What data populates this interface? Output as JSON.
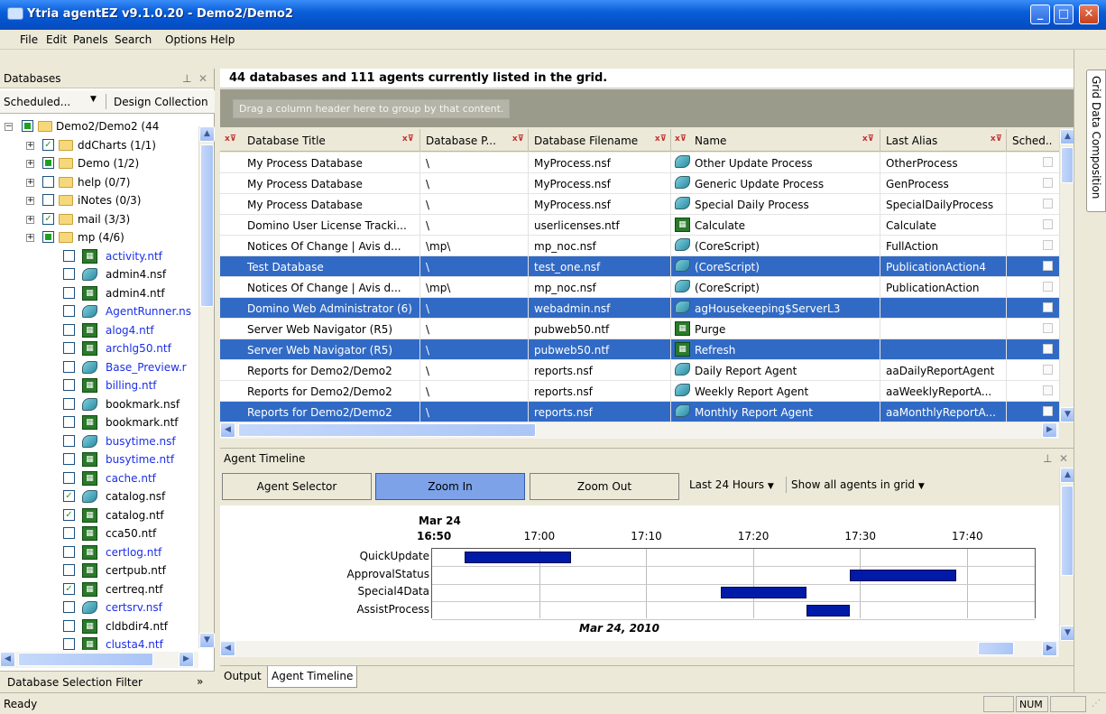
{
  "window": {
    "title": "Ytria agentEZ v9.1.0.20 - Demo2/Demo2",
    "min": "_",
    "max": "□",
    "close": "✕"
  },
  "menu": [
    "File",
    "Edit",
    "Panels",
    "Search",
    "Options",
    "Help"
  ],
  "databases_panel": {
    "title": "Databases",
    "pin": "⊥",
    "close": "✕",
    "tab_scheduled": "Scheduled...",
    "tab_design": "Design Collection",
    "tree": [
      {
        "label": "Demo2/Demo2 (44",
        "kind": "root"
      },
      {
        "label": "ddCharts (1/1)",
        "kind": "folder",
        "check": "checked"
      },
      {
        "label": "Demo (1/2)",
        "kind": "folder",
        "check": "partial"
      },
      {
        "label": "help (0/7)",
        "kind": "folder",
        "check": "none"
      },
      {
        "label": "iNotes (0/3)",
        "kind": "folder",
        "check": "none"
      },
      {
        "label": "mail (3/3)",
        "kind": "folder",
        "check": "checked"
      },
      {
        "label": "mp (4/6)",
        "kind": "folder",
        "check": "partial"
      },
      {
        "label": "activity.ntf",
        "kind": "nsf",
        "blue": true
      },
      {
        "label": "admin4.nsf",
        "kind": "agent",
        "blue": false
      },
      {
        "label": "admin4.ntf",
        "kind": "nsf",
        "blue": false
      },
      {
        "label": "AgentRunner.ns",
        "kind": "agent",
        "blue": true
      },
      {
        "label": "alog4.ntf",
        "kind": "nsf",
        "blue": true
      },
      {
        "label": "archlg50.ntf",
        "kind": "nsf",
        "blue": true
      },
      {
        "label": "Base_Preview.r",
        "kind": "agent",
        "blue": true
      },
      {
        "label": "billing.ntf",
        "kind": "nsf",
        "blue": true
      },
      {
        "label": "bookmark.nsf",
        "kind": "agent",
        "blue": false
      },
      {
        "label": "bookmark.ntf",
        "kind": "nsf",
        "blue": false
      },
      {
        "label": "busytime.nsf",
        "kind": "agent",
        "blue": true
      },
      {
        "label": "busytime.ntf",
        "kind": "nsf",
        "blue": true
      },
      {
        "label": "cache.ntf",
        "kind": "nsf",
        "blue": true
      },
      {
        "label": "catalog.nsf",
        "kind": "agent",
        "blue": false,
        "check": "checked"
      },
      {
        "label": "catalog.ntf",
        "kind": "nsf",
        "blue": false,
        "check": "checked"
      },
      {
        "label": "cca50.ntf",
        "kind": "nsf",
        "blue": false
      },
      {
        "label": "certlog.ntf",
        "kind": "nsf",
        "blue": true
      },
      {
        "label": "certpub.ntf",
        "kind": "nsf",
        "blue": false
      },
      {
        "label": "certreq.ntf",
        "kind": "nsf",
        "blue": false,
        "check": "checked"
      },
      {
        "label": "certsrv.nsf",
        "kind": "agent",
        "blue": true
      },
      {
        "label": "cldbdir4.ntf",
        "kind": "nsf",
        "blue": false
      },
      {
        "label": "clusta4.ntf",
        "kind": "nsf",
        "blue": true
      }
    ],
    "filter_label": "Database Selection Filter"
  },
  "grid": {
    "summary": "44 databases and 111 agents currently listed in the grid.",
    "group_hint": "Drag a column header here to group by that content.",
    "columns": [
      "Database Title",
      "Database P...",
      "Database Filename",
      "Name",
      "Last Alias",
      "Sched.."
    ],
    "rows": [
      {
        "title": "My Process Database",
        "path": "\\",
        "file": "MyProcess.nsf",
        "name": "Other Update Process",
        "alias": "OtherProcess",
        "icon": "agent",
        "sel": false
      },
      {
        "title": "My Process Database",
        "path": "\\",
        "file": "MyProcess.nsf",
        "name": "Generic Update Process",
        "alias": "GenProcess",
        "icon": "agent",
        "sel": false
      },
      {
        "title": "My Process Database",
        "path": "\\",
        "file": "MyProcess.nsf",
        "name": "Special Daily Process",
        "alias": "SpecialDailyProcess",
        "icon": "agent",
        "sel": false
      },
      {
        "title": "Domino User License Tracki...",
        "path": "\\",
        "file": "userlicenses.ntf",
        "name": "Calculate",
        "alias": "Calculate",
        "icon": "formula",
        "sel": false
      },
      {
        "title": "Notices Of Change | Avis d...",
        "path": "\\mp\\",
        "file": "mp_noc.nsf",
        "name": "(CoreScript)",
        "alias": "FullAction",
        "icon": "agent",
        "sel": false
      },
      {
        "title": "Test Database",
        "path": "\\",
        "file": "test_one.nsf",
        "name": "(CoreScript)",
        "alias": "PublicationAction4",
        "icon": "agent",
        "sel": true
      },
      {
        "title": "Notices Of Change | Avis d...",
        "path": "\\mp\\",
        "file": "mp_noc.nsf",
        "name": "(CoreScript)",
        "alias": "PublicationAction",
        "icon": "agent",
        "sel": false
      },
      {
        "title": "Domino Web Administrator (6)",
        "path": "\\",
        "file": "webadmin.nsf",
        "name": "agHousekeeping$ServerL3",
        "alias": "",
        "icon": "agent",
        "sel": true
      },
      {
        "title": "Server Web Navigator (R5)",
        "path": "\\",
        "file": "pubweb50.ntf",
        "name": "Purge",
        "alias": "",
        "icon": "formula",
        "sel": false
      },
      {
        "title": "Server Web Navigator (R5)",
        "path": "\\",
        "file": "pubweb50.ntf",
        "name": "Refresh",
        "alias": "",
        "icon": "formula",
        "sel": true
      },
      {
        "title": "Reports for Demo2/Demo2",
        "path": "\\",
        "file": "reports.nsf",
        "name": "Daily Report Agent",
        "alias": "aaDailyReportAgent",
        "icon": "agent",
        "sel": false
      },
      {
        "title": "Reports for Demo2/Demo2",
        "path": "\\",
        "file": "reports.nsf",
        "name": "Weekly Report Agent",
        "alias": "aaWeeklyReportA...",
        "icon": "agent",
        "sel": false
      },
      {
        "title": "Reports for Demo2/Demo2",
        "path": "\\",
        "file": "reports.nsf",
        "name": "Monthly Report Agent",
        "alias": "aaMonthlyReportA...",
        "icon": "agent",
        "sel": true
      }
    ]
  },
  "timeline": {
    "panel_title": "Agent Timeline",
    "btn_selector": "Agent Selector",
    "btn_zoom_in": "Zoom In",
    "btn_zoom_out": "Zoom Out",
    "range": "Last 24 Hours",
    "filter": "Show all agents in grid",
    "date_top": "Mar 24",
    "ticks": [
      "16:50",
      "17:00",
      "17:10",
      "17:20",
      "17:30",
      "17:40"
    ],
    "date_bottom": "Mar 24, 2010",
    "agents": [
      {
        "name": "QuickUpdate",
        "start": "16:53",
        "end": "17:03"
      },
      {
        "name": "ApprovalStatus",
        "start": "17:29",
        "end": "17:39"
      },
      {
        "name": "Special4Data",
        "start": "17:17",
        "end": "17:25"
      },
      {
        "name": "AssistProcess",
        "start": "17:25",
        "end": "17:29"
      }
    ]
  },
  "bottom_tabs": [
    "Output",
    "Agent Timeline"
  ],
  "side_tab": "Grid Data Composition",
  "status": {
    "text": "Ready",
    "num": "NUM"
  }
}
